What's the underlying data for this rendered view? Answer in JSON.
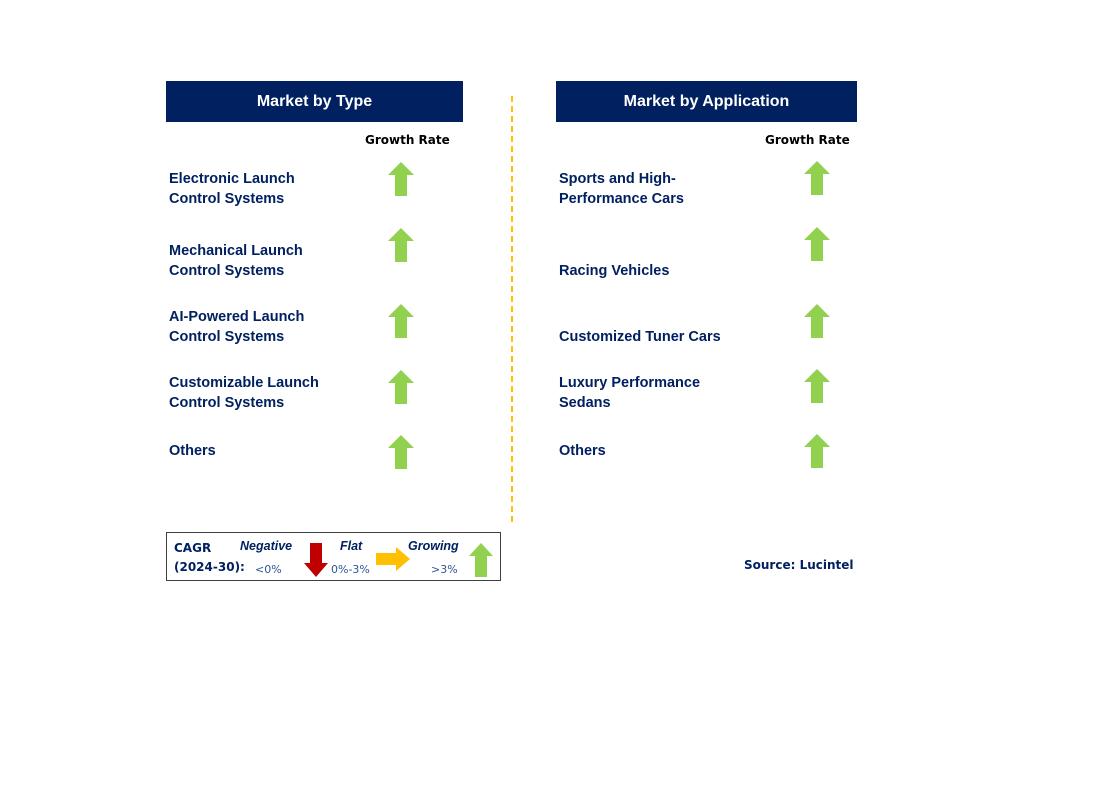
{
  "left_panel": {
    "title": "Market by Type",
    "growth_rate_label": "Growth Rate",
    "items": [
      {
        "label": "Electronic Launch\nControl Systems",
        "trend": "growing"
      },
      {
        "label": "Mechanical Launch\nControl Systems",
        "trend": "growing"
      },
      {
        "label": "AI-Powered Launch\nControl Systems",
        "trend": "growing"
      },
      {
        "label": "Customizable Launch\nControl Systems",
        "trend": "growing"
      },
      {
        "label": "Others",
        "trend": "growing"
      }
    ]
  },
  "right_panel": {
    "title": "Market by Application",
    "growth_rate_label": "Growth Rate",
    "items": [
      {
        "label": "Sports and High-\nPerformance Cars",
        "trend": "growing"
      },
      {
        "label": "Racing Vehicles",
        "trend": "growing"
      },
      {
        "label": "Customized Tuner Cars",
        "trend": "growing"
      },
      {
        "label": "Luxury Performance\nSedans",
        "trend": "growing"
      },
      {
        "label": "Others",
        "trend": "growing"
      }
    ]
  },
  "legend": {
    "cagr_line1": "CAGR",
    "cagr_line2": "(2024-30):",
    "negative_label": "Negative",
    "negative_value": "<0%",
    "flat_label": "Flat",
    "flat_value": "0%-3%",
    "growing_label": "Growing",
    "growing_value": ">3%"
  },
  "source": "Source: Lucintel",
  "colors": {
    "header_bg": "#002060",
    "text": "#002060",
    "growing": "#92D050",
    "negative": "#C00000",
    "flat": "#FFC000",
    "divider": "#FFC000"
  }
}
